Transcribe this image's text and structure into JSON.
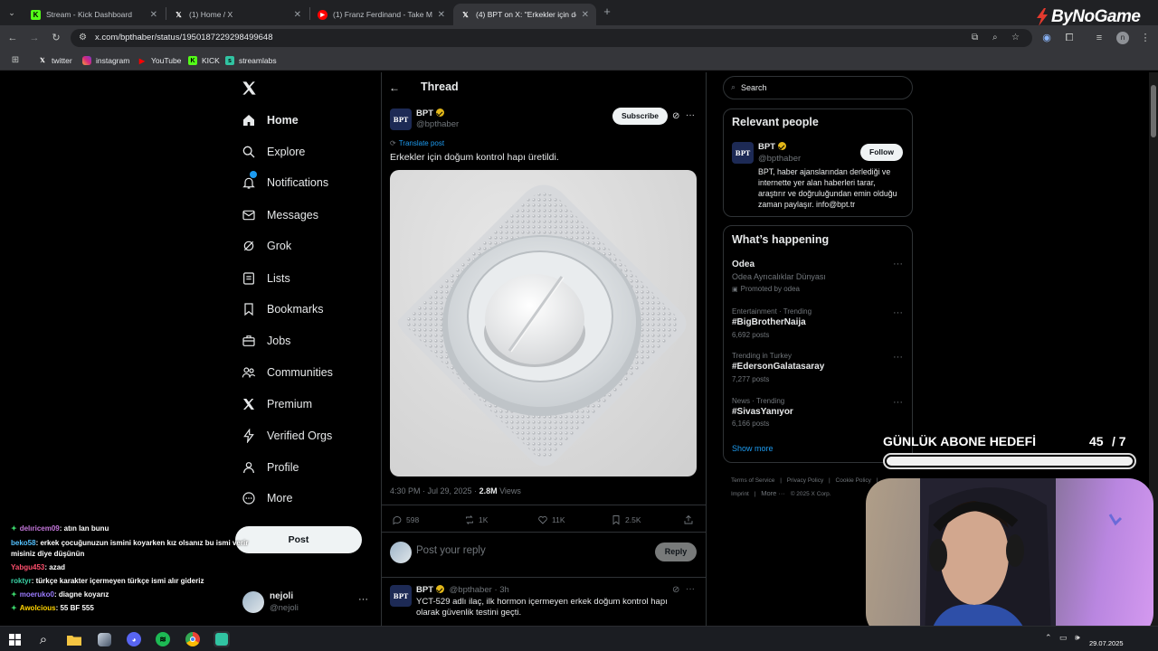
{
  "browser": {
    "tabs": [
      {
        "title": "Stream - Kick Dashboard",
        "icon": "kick-icon",
        "active": false
      },
      {
        "title": "(1) Home / X",
        "icon": "x-icon",
        "active": false
      },
      {
        "title": "(1) Franz Ferdinand - Take M",
        "icon": "youtube-icon",
        "active": false
      },
      {
        "title": "(4) BPT on X: \"Erkekler için doğu",
        "icon": "x-icon",
        "active": true
      }
    ],
    "url": "x.com/bpthaber/status/1950187229298499648",
    "bookmarks": [
      {
        "label": "twitter",
        "icon": "x-icon"
      },
      {
        "label": "instagram",
        "icon": "instagram-icon"
      },
      {
        "label": "YouTube",
        "icon": "youtube-icon"
      },
      {
        "label": "KICK",
        "icon": "kick-icon"
      },
      {
        "label": "streamlabs",
        "icon": "streamlabs-icon"
      }
    ],
    "profile_initial": "n"
  },
  "watermark": "ByNoGame",
  "nav": {
    "items": [
      {
        "label": "Home",
        "icon": "home-icon"
      },
      {
        "label": "Explore",
        "icon": "search-icon"
      },
      {
        "label": "Notifications",
        "icon": "bell-icon"
      },
      {
        "label": "Messages",
        "icon": "mail-icon"
      },
      {
        "label": "Grok",
        "icon": "grok-icon"
      },
      {
        "label": "Lists",
        "icon": "list-icon"
      },
      {
        "label": "Bookmarks",
        "icon": "bookmark-icon"
      },
      {
        "label": "Jobs",
        "icon": "briefcase-icon"
      },
      {
        "label": "Communities",
        "icon": "people-icon"
      },
      {
        "label": "Premium",
        "icon": "x-icon"
      },
      {
        "label": "Verified Orgs",
        "icon": "lightning-icon"
      },
      {
        "label": "Profile",
        "icon": "person-icon"
      },
      {
        "label": "More",
        "icon": "more-circle-icon"
      }
    ],
    "post_label": "Post",
    "account": {
      "name": "nejoli",
      "handle": "@nejoli"
    }
  },
  "thread": {
    "header": "Thread",
    "author": {
      "name": "BPT",
      "handle": "@bpthaber",
      "avatar_text": "BPT"
    },
    "subscribe_label": "Subscribe",
    "translate_label": "Translate post",
    "text": "Erkekler için doğum kontrol hapı üretildi.",
    "meta_time": "4:30 PM · Jul 29, 2025 · ",
    "meta_views_count": "2.8M",
    "meta_views_label": " Views",
    "stats": {
      "replies": "598",
      "reposts": "1K",
      "likes": "11K",
      "bookmarks": "2.5K"
    },
    "reply_placeholder": "Post your reply",
    "reply_label": "Reply",
    "reply_post": {
      "name": "BPT",
      "handle": "@bpthaber",
      "time": "· 3h",
      "text": "YCT-529 adlı ilaç, ilk hormon içermeyen erkek doğum kontrol hapı olarak güvenlik testini geçti."
    }
  },
  "sidebar": {
    "search_placeholder": "Search",
    "relevant_title": "Relevant people",
    "person": {
      "name": "BPT",
      "handle": "@bpthaber",
      "follow_label": "Follow",
      "bio": "BPT, haber ajanslarından derlediği ve internette yer alan haberleri tarar, araştırır ve doğruluğundan emin olduğu zaman paylaşır. info@bpt.tr"
    },
    "happening_title": "What’s happening",
    "promo": {
      "title": "Odea",
      "subtitle": "Odea Ayrıcalıklar Dünyası",
      "promoted": "Promoted by odea"
    },
    "trends": [
      {
        "context": "Entertainment · Trending",
        "name": "#BigBrotherNaija",
        "posts": "6,692 posts"
      },
      {
        "context": "Trending in Turkey",
        "name": "#EdersonGalatasaray",
        "posts": "7,277 posts"
      },
      {
        "context": "News · Trending",
        "name": "#SivasYanıyor",
        "posts": "6,166 posts"
      }
    ],
    "show_more": "Show more",
    "footer": [
      "Terms of Service",
      "Privacy Policy",
      "Cookie Policy",
      "Imprint",
      "More ···",
      "© 2025 X Corp."
    ]
  },
  "overlay": {
    "goal_label": "GÜNLÜK ABONE HEDEFİ",
    "goal_current": "45",
    "goal_target": "/ 7",
    "goal_progress": 1.0
  },
  "chat": [
    {
      "user": "delıricem09",
      "message": ": atın lan bunu",
      "color": "#c678dd",
      "badge": true
    },
    {
      "user": "beko58",
      "message": ": erkek çocuğunuzun ismini koyarken kız olsanız bu ismi verir",
      "color": "#53c1ff",
      "badge": false
    },
    {
      "user": "",
      "message": "misiniz diye düşünün",
      "color": "#53c1ff",
      "badge": false
    },
    {
      "user": "Yabgu453",
      "message": ": azad",
      "color": "#ff4f6d",
      "badge": false
    },
    {
      "user": "roktyr",
      "message": ": türkçe karakter içermeyen türkçe ismi alır gideriz",
      "color": "#3ad3a6",
      "badge": false
    },
    {
      "user": "moeruko0",
      "message": ": diagne koyarız",
      "color": "#9b7bff",
      "badge": true
    },
    {
      "user": "Awolcious",
      "message": ": 55 BF 555",
      "color": "#ffd400",
      "badge": true
    }
  ],
  "taskbar": {
    "date": "29.07.2025"
  }
}
